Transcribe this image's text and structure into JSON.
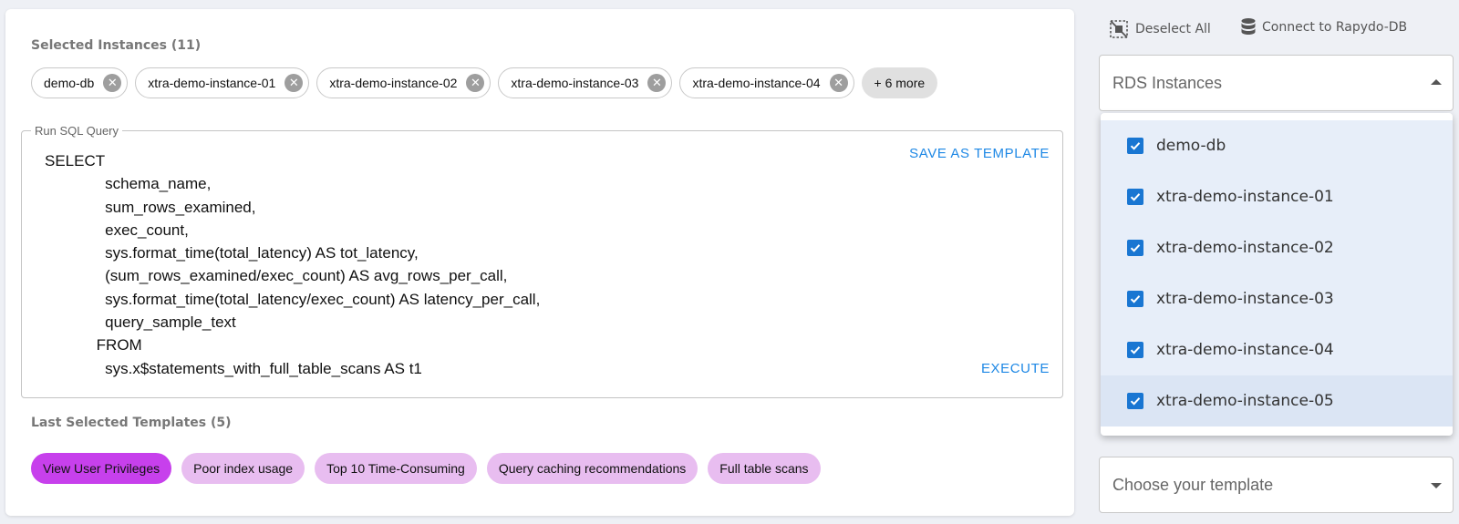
{
  "selected": {
    "title": "Selected Instances (11)",
    "chips": [
      "demo-db",
      "xtra-demo-instance-01",
      "xtra-demo-instance-02",
      "xtra-demo-instance-03",
      "xtra-demo-instance-04"
    ],
    "more": "+ 6 more"
  },
  "sql": {
    "legend": "Run SQL Query",
    "query": "SELECT\n              schema_name,\n              sum_rows_examined,\n              exec_count,\n              sys.format_time(total_latency) AS tot_latency,\n              (sum_rows_examined/exec_count) AS avg_rows_per_call,\n              sys.format_time(total_latency/exec_count) AS latency_per_call,\n              query_sample_text\n            FROM\n              sys.x$statements_with_full_table_scans AS t1",
    "save_label": "SAVE AS TEMPLATE",
    "execute_label": "EXECUTE"
  },
  "templates": {
    "title": "Last Selected Templates (5)",
    "items": [
      "View User Privileges",
      "Poor index usage",
      "Top 10 Time-Consuming",
      "Query caching recommendations",
      "Full table scans"
    ],
    "active_color": "#c740ec",
    "color": "#e8bdf0"
  },
  "actions": {
    "deselect_label": "Deselect All",
    "connect_label": "Connect to Rapydo-DB"
  },
  "rds": {
    "label": "RDS Instances",
    "options": [
      "demo-db",
      "xtra-demo-instance-01",
      "xtra-demo-instance-02",
      "xtra-demo-instance-03",
      "xtra-demo-instance-04",
      "xtra-demo-instance-05"
    ],
    "checked_color": "#1976d2"
  },
  "template_select": {
    "placeholder": "Choose your template"
  },
  "accent": "#1e88e5"
}
